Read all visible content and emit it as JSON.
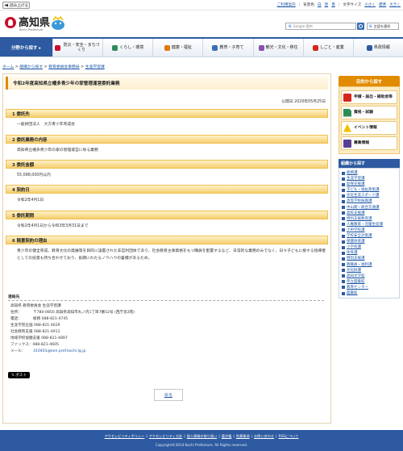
{
  "utility": {
    "voice_label": "読み上げる",
    "links": [
      "ご利用案内"
    ],
    "bg_color_label": "背景色",
    "bg_options": [
      "白",
      "黒",
      "青"
    ],
    "text_size_label": "文字サイズ",
    "text_size_options": [
      "小さく",
      "標準",
      "大きく"
    ]
  },
  "header": {
    "logo_text": "高知県",
    "logo_sub": "Kochi Prefecture",
    "search_placeholder": "Google 提供",
    "search_brand": "G",
    "lang_label": "言語を選択"
  },
  "gnav": {
    "first": "分野から探す ▸",
    "items": [
      "防災・安全・まちづくり",
      "くらし・環境",
      "健康・福祉",
      "教育・子育て",
      "観光・文化・移住",
      "しごと・産業",
      "県政情報"
    ],
    "icon_colors": [
      "#c8102e",
      "#2e8b57",
      "#e07a10",
      "#3a6fb5",
      "#8a4fb0",
      "#d7261e",
      "#2d5aa0"
    ]
  },
  "breadcrumb": {
    "items": [
      "ホーム",
      "組織から探す",
      "教育委員会事務局",
      "生涯学習課"
    ],
    "separator": ">"
  },
  "page": {
    "title": "令和2年度高知県立幡多青少年の家管理運営委託業務",
    "pub_date": "公開日 2020年05月25日",
    "sections": [
      {
        "heading": "1 委託先",
        "text": "一般財団法人　大方青少年育成会"
      },
      {
        "heading": "2 委託業務の内容",
        "text": "高知県立幡多青少年の家の管理運営に係る業務"
      },
      {
        "heading": "3 委託金額",
        "text": "55,098,000円以内"
      },
      {
        "heading": "4 契約日",
        "text": "令和2年4月1日"
      },
      {
        "heading": "5 委託期間",
        "text": "令和2年4月1日から令和3年3月31日まで"
      },
      {
        "heading": "6 随意契約の理由",
        "text": "青少年の健全育成、教育文化の発展等を目的に設置された非営利団体であり、社会教育主事資格をもつ職員を配置するなど、日常的な業務のみでなく、日々子どもに接する指導者としての技量も持ち合わせており、長期にわたるノウハウの蓄積があるため。"
      }
    ]
  },
  "contact": {
    "heading": "連絡先",
    "org": "高知県 教育委員会 生涯学習課",
    "address_label": "住所：",
    "address": "〒780-0850 高知県高知市丸ノ内1丁目7番52号 (西庁舎2階)",
    "tel_label": "電話：",
    "tels": [
      "総務 088-821-4745",
      "生涯学習企画 088-821-4629",
      "社会教育支援 088-821-4911",
      "地域学校協働支援 088-821-4897"
    ],
    "fax_label": "ファックス：",
    "fax": "088-821-4605",
    "mail_label": "メール：",
    "mail": "310401@ken.pref.kochi.lg.jp"
  },
  "share": {
    "post_label": "𝕏 ポスト"
  },
  "back": {
    "label": "戻る"
  },
  "sidebar": {
    "purpose_heading": "目的から探す",
    "purpose_items": [
      {
        "label": "申請・届出・補助金等",
        "icon": "application-form-icon"
      },
      {
        "label": "資格・試験",
        "icon": "document-icon"
      },
      {
        "label": "イベント情報",
        "icon": "event-icon"
      },
      {
        "label": "募集情報",
        "icon": "recruitment-icon"
      }
    ],
    "org_heading": "組織から探す",
    "org_items": [
      "総務課",
      "生涯学習課",
      "幼保支援課",
      "子ども・福祉政策課",
      "文化生涯スポーツ課",
      "高等学校振興課",
      "中山間・総合交通課",
      "高校支援課",
      "特別支援教育課",
      "人権教育・児童生徒課",
      "小中学校課",
      "学校安全対策課",
      "保健体育課",
      "小学校課",
      "体育課",
      "特別支援課",
      "教職員・福利課",
      "文化財課",
      "高知文学館",
      "県立図書館",
      "教育センター",
      "図書館"
    ]
  },
  "footer": {
    "links": [
      "アクセシビリティポリシー",
      "アクセシビリティ方針",
      "個人情報の取り扱い",
      "著作権",
      "免責事項",
      "お問い合わせ",
      "RSSについて"
    ],
    "copyright": "Copyright©2014 Kochi Prefecture. All Rights reserved."
  }
}
